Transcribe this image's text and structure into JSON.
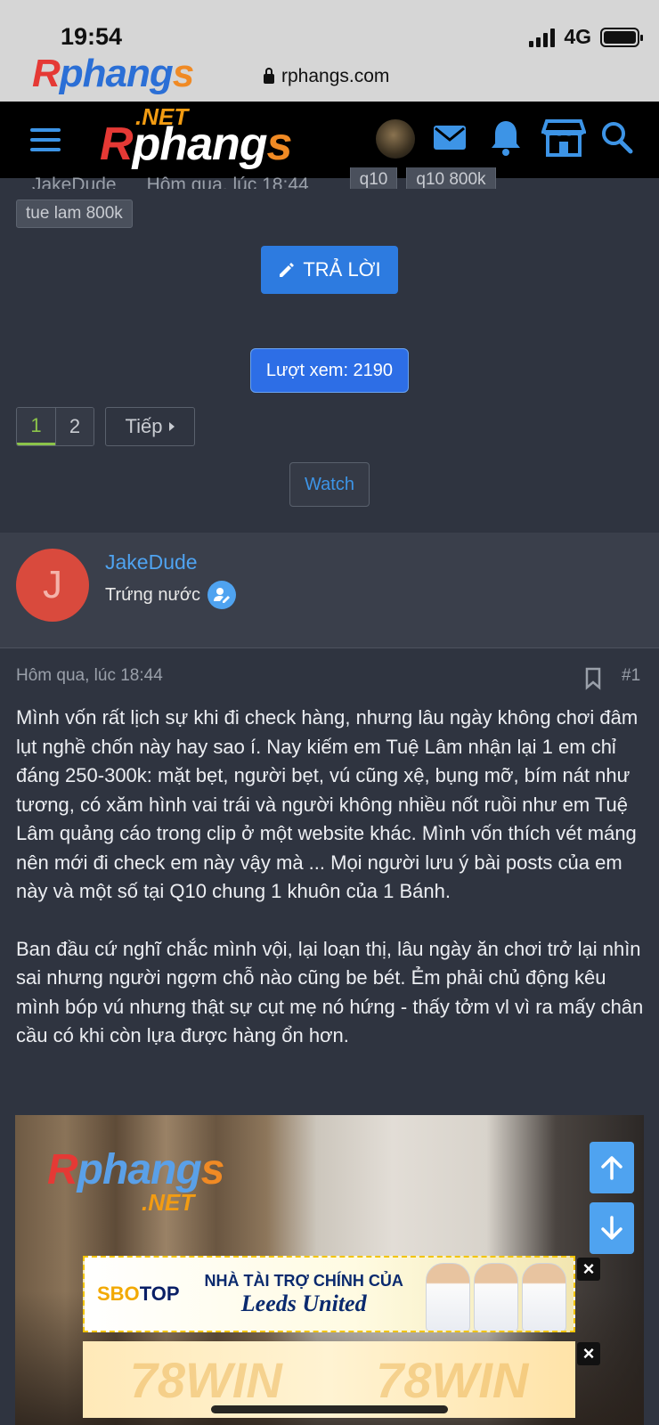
{
  "status": {
    "time": "19:54",
    "network": "4G"
  },
  "browser": {
    "url": "rphangs.com",
    "logo": {
      "r": "R",
      "phang": "phang",
      "s": "s"
    }
  },
  "header": {
    "brand": {
      "net": ".NET",
      "r": "R",
      "phang": "phang",
      "s": "s"
    },
    "icons": [
      "menu-icon",
      "avatar",
      "mail-icon",
      "bell-icon",
      "store-icon",
      "search-icon"
    ]
  },
  "thread": {
    "author": "JakeDude",
    "date": "Hôm qua, lúc 18:44",
    "tags": [
      "q10",
      "q10 800k",
      "tue lam 800k"
    ],
    "reply_label": "TRẢ LỜI",
    "views_label": "Lượt xem: 2190",
    "pages": [
      "1",
      "2"
    ],
    "next_label": "Tiếp",
    "watch_label": "Watch"
  },
  "post": {
    "avatar_letter": "J",
    "username": "JakeDude",
    "user_title": "Trứng nước",
    "date": "Hôm qua, lúc 18:44",
    "number": "#1",
    "paragraphs": [
      "Mình vốn rất lịch sự khi đi check hàng, nhưng lâu ngày không chơi đâm lụt nghề chốn này hay sao í. Nay kiếm em Tuệ Lâm nhận lại 1 em chỉ đáng 250-300k: mặt bẹt, người bẹt, vú cũng xệ, bụng mỡ, bím nát như tương, có xăm hình vai trái và người không nhiều nốt ruồi như em Tuệ Lâm quảng cáo trong clip ở một website khác. Mình vốn thích vét máng nên mới đi check em này vậy mà ... Mọi người lưu ý bài posts của em này và một số tại Q10 chung 1 khuôn của 1 Bánh.",
      "Ban đầu cứ nghĩ chắc mình vội, lại loạn thị, lâu ngày ăn chơi trở lại nhìn sai nhưng người ngợm chỗ nào cũng be bét. Ẻm phải chủ động kêu mình bóp vú nhưng thật sự cụt mẹ nó hứng - thấy tởm vl vì ra mấy chân cầu có khi còn lựa được hàng ổn hơn."
    ],
    "image_watermark": {
      "r": "R",
      "phang": "phang",
      "s": "s",
      "net": ".NET"
    }
  },
  "ads": {
    "ad1": {
      "brand_a": "SBO",
      "brand_b": "TOP",
      "line1": "NHÀ TÀI TRỢ CHÍNH CỦA",
      "line2": "Leeds United"
    },
    "ad2": {
      "text": "78WIN"
    },
    "close": "×"
  },
  "colors": {
    "accent": "#2d7be0",
    "link": "#4fa3f0",
    "active_page": "#8bc34a",
    "avatar": "#d94a3d"
  }
}
